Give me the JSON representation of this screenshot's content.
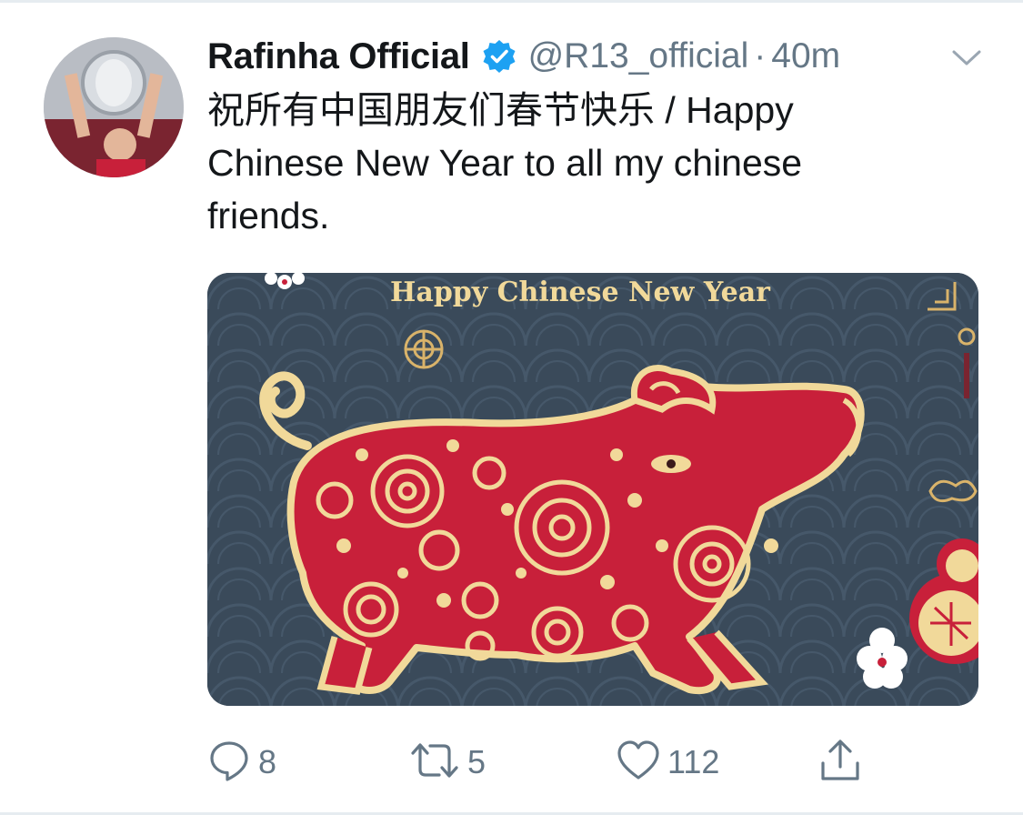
{
  "tweet": {
    "author": {
      "display_name": "Rafinha Official",
      "handle": "@R13_official",
      "verified": true
    },
    "separator": "·",
    "time": "40m",
    "text": "祝所有中国朋友们春节快乐 / Happy Chinese New Year to all my chinese friends.",
    "media": {
      "caption": "Happy Chinese New Year"
    },
    "actions": {
      "replies": "8",
      "retweets": "5",
      "likes": "112"
    }
  },
  "icons": {
    "verified": "verified-badge-icon",
    "menu": "chevron-down-icon",
    "reply": "reply-icon",
    "retweet": "retweet-icon",
    "like": "heart-icon",
    "share": "share-icon"
  },
  "colors": {
    "text": "#14171a",
    "secondary": "#657786",
    "verified": "#1da1f2",
    "image_background": "#3a4a5a",
    "pig_red": "#c8203a",
    "gold": "#f1d99a"
  }
}
